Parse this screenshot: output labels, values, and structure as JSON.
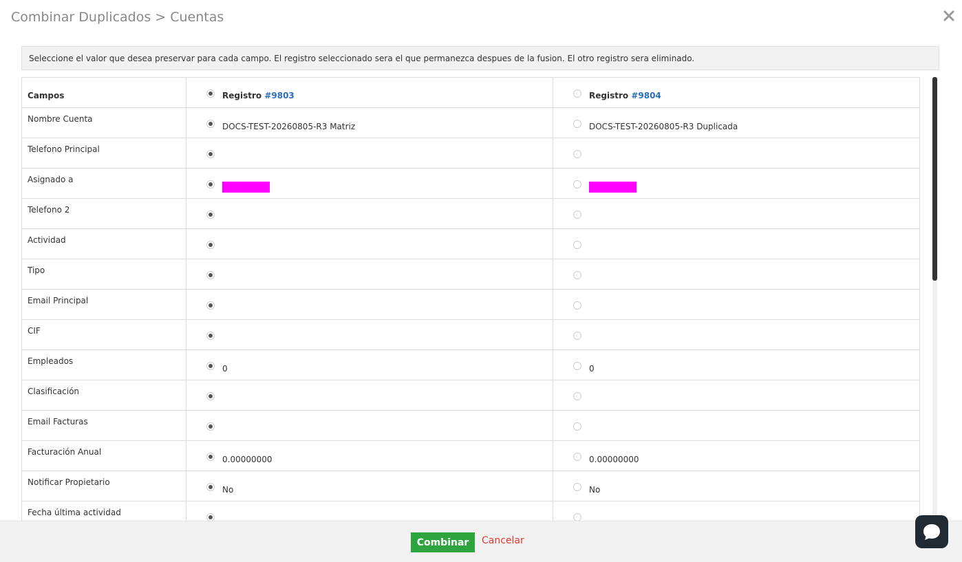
{
  "header": {
    "title": "Combinar Duplicados > Cuentas"
  },
  "notice": "Seleccione el valor que desea preservar para cada campo. El registro seleccionado sera el que permanezca despues de la fusion. El otro registro sera eliminado.",
  "table": {
    "field_header": "Campos",
    "records": [
      {
        "label": "Registro",
        "id": "#9803",
        "selected": true
      },
      {
        "label": "Registro",
        "id": "#9804",
        "selected": false
      }
    ],
    "rows": [
      {
        "field": "Nombre Cuenta",
        "a": "DOCS-TEST-20260805-R3 Matriz",
        "b": "DOCS-TEST-20260805-R3 Duplicada"
      },
      {
        "field": "Telefono Principal",
        "a": "",
        "b": ""
      },
      {
        "field": "Asignado a",
        "a": "",
        "b": "",
        "redacted": true
      },
      {
        "field": "Telefono 2",
        "a": "",
        "b": ""
      },
      {
        "field": "Actividad",
        "a": "",
        "b": ""
      },
      {
        "field": "Tipo",
        "a": "",
        "b": ""
      },
      {
        "field": "Email Principal",
        "a": "",
        "b": ""
      },
      {
        "field": "CIF",
        "a": "",
        "b": ""
      },
      {
        "field": "Empleados",
        "a": "0",
        "b": "0"
      },
      {
        "field": "Clasificación",
        "a": "",
        "b": ""
      },
      {
        "field": "Email Facturas",
        "a": "",
        "b": ""
      },
      {
        "field": "Facturación Anual",
        "a": "0.00000000",
        "b": "0.00000000"
      },
      {
        "field": "Notificar Propietario",
        "a": "No",
        "b": "No"
      },
      {
        "field": "Fecha última actividad",
        "a": "",
        "b": ""
      }
    ]
  },
  "footer": {
    "merge_label": "Combinar",
    "cancel_label": "Cancelar"
  },
  "colors": {
    "merge_button": "#2ea43f",
    "cancel_link": "#e03a2e",
    "record_link": "#2a6ebb",
    "redaction": "#ff00ff"
  },
  "icons": {
    "close": "close-icon",
    "chat": "chat-icon"
  }
}
